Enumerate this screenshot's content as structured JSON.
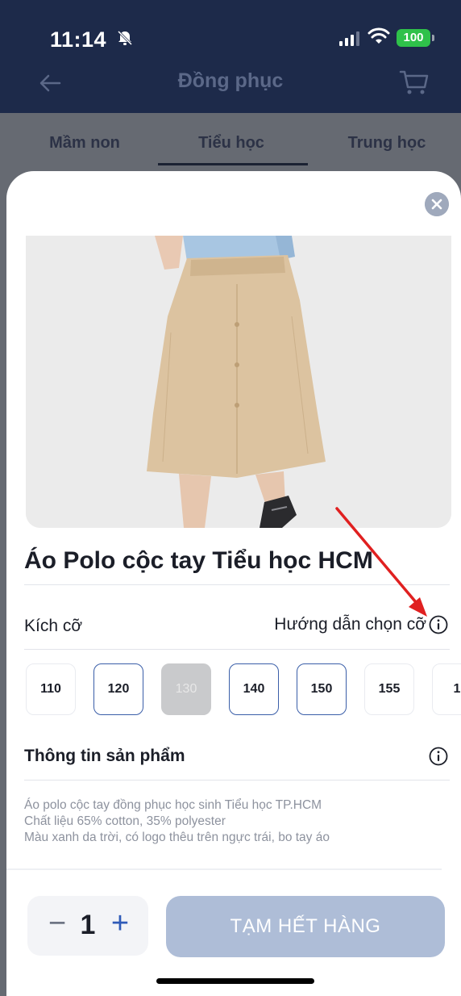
{
  "status_bar": {
    "time": "11:14",
    "battery": "100"
  },
  "nav": {
    "title": "Đồng phục"
  },
  "tabs": [
    {
      "label": "Mầm non"
    },
    {
      "label": "Tiểu học"
    },
    {
      "label": "Trung học"
    }
  ],
  "product": {
    "title": "Áo Polo cộc tay Tiểu học HCM",
    "size_label": "Kích cỡ",
    "size_guide_label": "Hướng dẫn chọn cỡ",
    "sizes": [
      {
        "label": "110",
        "state": "normal"
      },
      {
        "label": "120",
        "state": "selected"
      },
      {
        "label": "130",
        "state": "disabled"
      },
      {
        "label": "140",
        "state": "selected"
      },
      {
        "label": "150",
        "state": "selected"
      },
      {
        "label": "155",
        "state": "normal"
      },
      {
        "label": "1",
        "state": "normal"
      }
    ],
    "info_label": "Thông tin sản phẩm",
    "description": [
      "Áo polo cộc tay đồng phục học sinh Tiểu học TP.HCM",
      "Chất liệu 65% cotton, 35% polyester",
      "Màu xanh da trời, có logo thêu trên ngực trái, bo tay áo"
    ]
  },
  "footer": {
    "quantity": "1",
    "minus_symbol": "−",
    "plus_symbol": "+",
    "buy_label": "TẠM HẾT HÀNG"
  },
  "colors": {
    "header_bg": "#1d2a4a",
    "accent": "#2f5bb8",
    "disabled_button": "#aebdd7",
    "annotation_arrow": "#e02020"
  },
  "icons": [
    "bell-muted-icon",
    "signal-icon",
    "wifi-icon",
    "battery-icon",
    "back-arrow-icon",
    "cart-icon",
    "close-icon",
    "info-icon"
  ]
}
